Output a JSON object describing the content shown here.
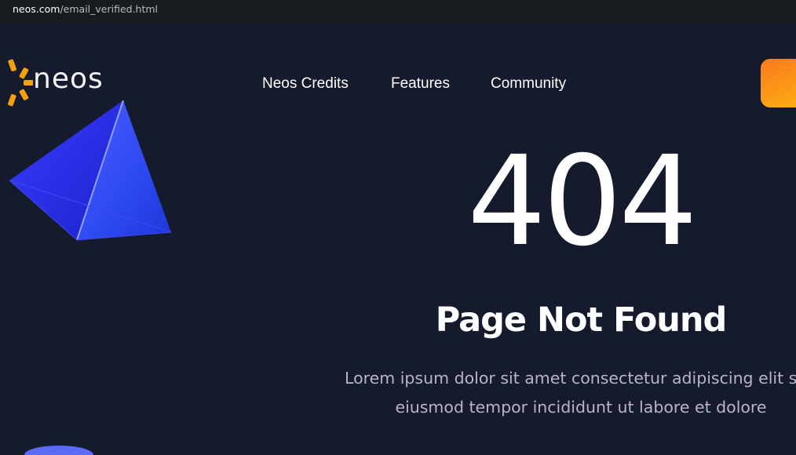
{
  "browser": {
    "url_host": "neos.com",
    "url_path": "/email_verified.html"
  },
  "header": {
    "brand": "neos",
    "logo_icon": "sun-burst-icon",
    "nav": [
      {
        "label": "Neos Credits"
      },
      {
        "label": "Features"
      },
      {
        "label": "Community"
      }
    ],
    "cta_colors": [
      "#f97a1d",
      "#ffb310"
    ]
  },
  "main": {
    "code": "404",
    "title": "Page Not Found",
    "description_line1": "Lorem ipsum dolor sit amet consectetur adipiscing elit sed",
    "description_line2": "eiusmod tempor incididunt ut labore et dolore"
  },
  "decorations": {
    "pyramid_icon": "blue-pyramid-icon",
    "blob_icon": "blue-sphere-icon"
  },
  "colors": {
    "background": "#151a2c",
    "accent_orange": "#f97a1d",
    "accent_blue": "#2a35ee",
    "text": "#ffffff",
    "muted_text": "#b7b6c6"
  }
}
